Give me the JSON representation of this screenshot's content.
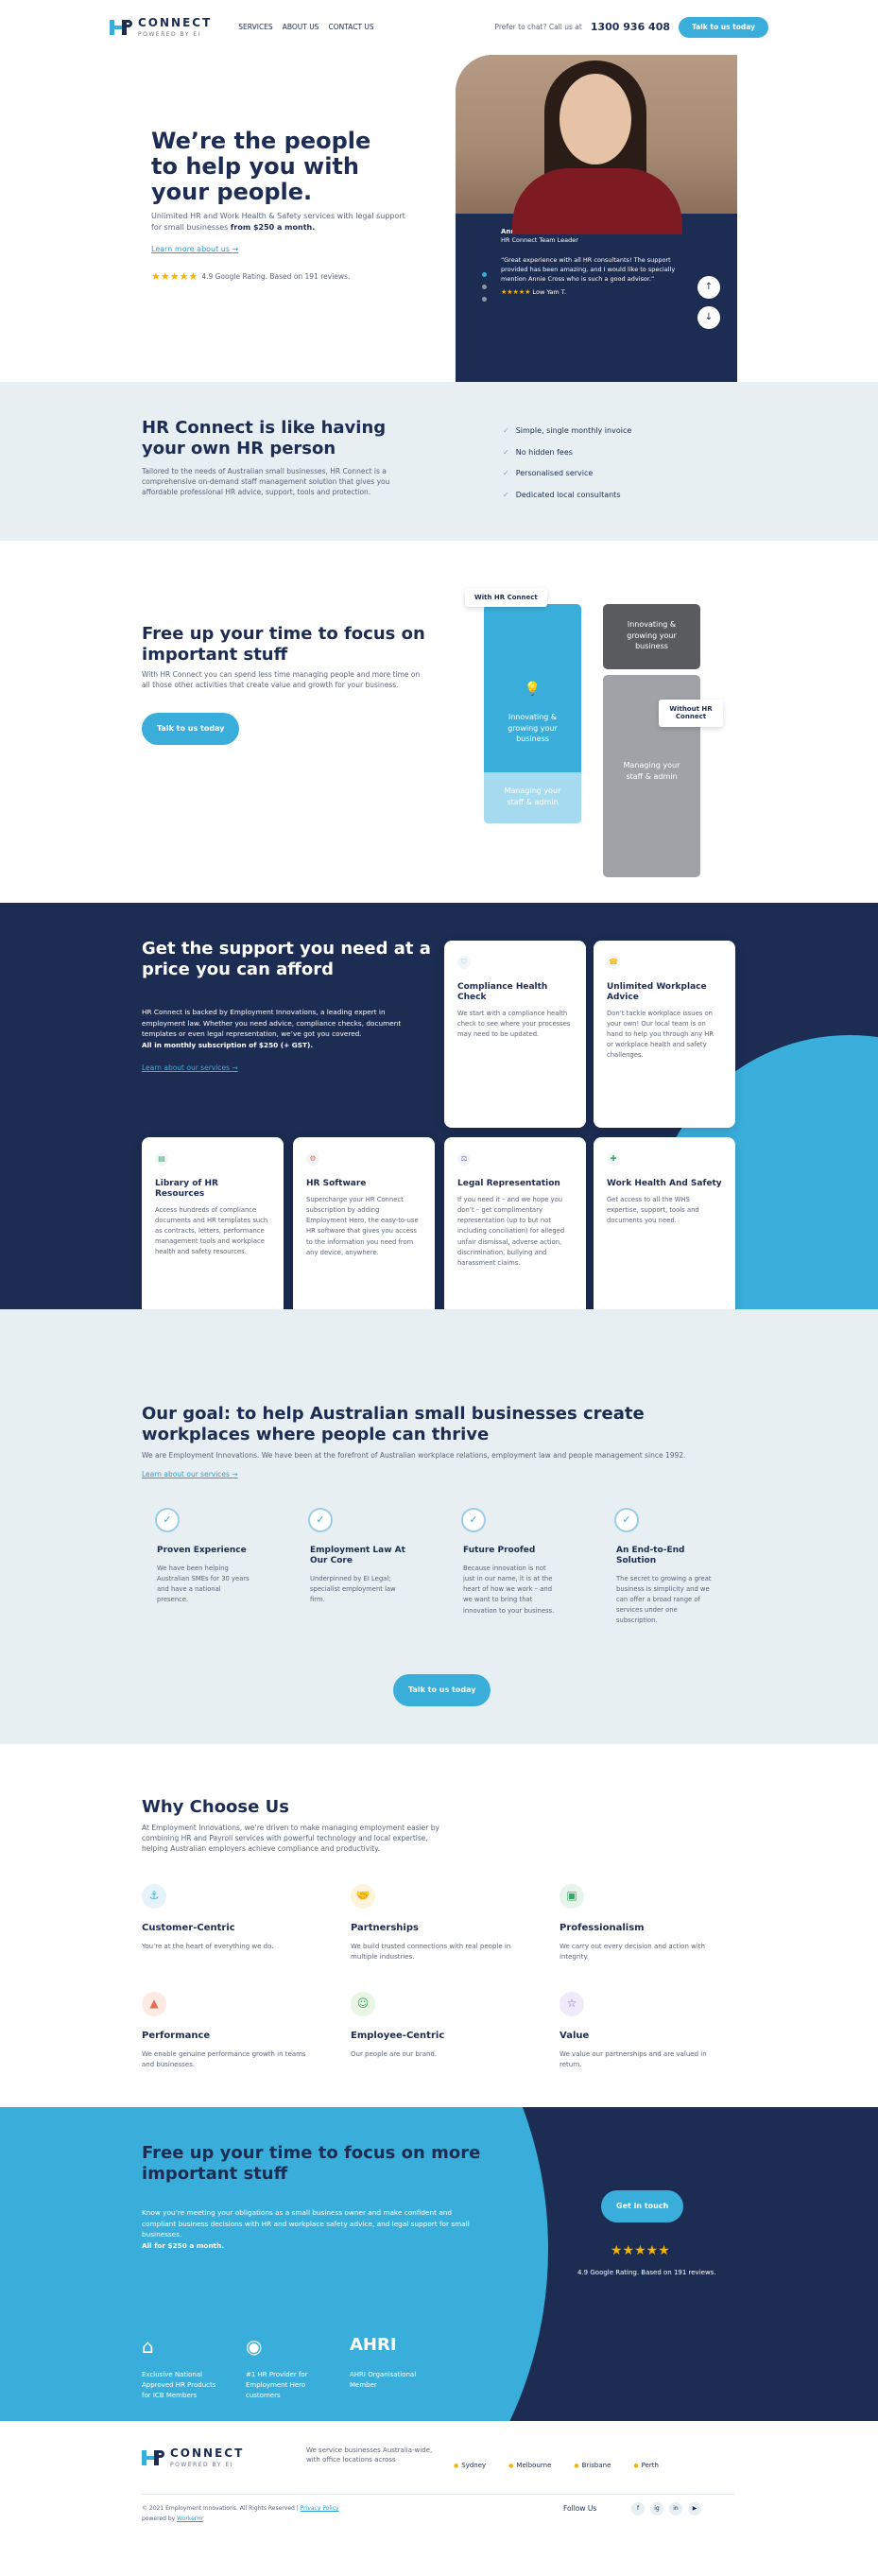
{
  "header": {
    "logo_text": "CONNECT",
    "logo_sub": "POWERED BY EI",
    "nav": [
      "SERVICES",
      "ABOUT US",
      "CONTACT US"
    ],
    "chat_prompt": "Prefer to chat? Call us at",
    "phone": "1300 936 408",
    "cta": "Talk to us today"
  },
  "hero": {
    "title": "We’re the people to help you with your people.",
    "subtitle": "Unlimited HR and Work Health & Safety services with legal support for small businesses",
    "price": "from $250 a month.",
    "learn": "Learn more about us →",
    "rating_stars": "★★★★★",
    "rating_text": "4.9 Google Rating. Based on 191 reviews.",
    "testimonial": {
      "name": "Annie",
      "role": "HR Connect Team Leader",
      "quote": "“Great experience with all HR consultants! The support provided has been amazing, and I would like to specially mention Annie Cross who is such a good advisor.”",
      "stars": "★★★★★",
      "author": "Low Yam T."
    },
    "arrow_up": "↑",
    "arrow_down": "↓"
  },
  "intro": {
    "title": "HR Connect is like having your own HR person",
    "text": "Tailored to the needs of Australian small businesses, HR Connect is a comprehensive on-demand staff management solution that gives you affordable professional HR advice, support, tools and protection.",
    "checks": [
      "Simple, single monthly invoice",
      "No hidden fees",
      "Personalised service",
      "Dedicated local consultants"
    ]
  },
  "free": {
    "title": "Free up your time to focus on important stuff",
    "text": "With HR Connect you can spend less time managing people and more time on all those other activities that create value and growth for your business.",
    "cta": "Talk to us today",
    "with_tag": "With HR Connect",
    "without_tag": "Without HR Connect",
    "with_main": "Innovating & growing your business",
    "with_bottom": "Managing your staff & admin",
    "without_top": "Innovating & growing your business",
    "without_main": "Managing your staff & admin"
  },
  "support": {
    "title": "Get the support you need at a price you can afford",
    "text": "HR Connect is backed by Employment Innovations, a leading expert in employment law. Whether you need advice, compliance checks, document templates or even legal representation, we’ve got you covered.",
    "price_line": "All in monthly subscription of $250 (+ GST).",
    "learn": "Learn about our services →",
    "cards": [
      {
        "icon": "♡",
        "title": "Compliance Health Check",
        "text": "We start with a compliance health check to see where your processes may need to be updated."
      },
      {
        "icon": "☎",
        "title": "Unlimited Workplace Advice",
        "text": "Don’t tackle workplace issues on your own! Our local team is on hand to help you through any HR or workplace health and safety challenges."
      },
      {
        "icon": "▤",
        "title": "Library of HR Resources",
        "text": "Access hundreds of compliance documents and HR templates such as contracts, letters, performance management tools and workplace health and safety resources."
      },
      {
        "icon": "⚙",
        "title": "HR Software",
        "text": "Supercharge your HR Connect subscription by adding Employment Hero, the easy-to-use HR software that gives you access to the information you need from any device, anywhere."
      },
      {
        "icon": "⚖",
        "title": "Legal Representation",
        "text": "If you need it – and we hope you don’t – get complimentary representation (up to but not including conciliation) for alleged unfair dismissal, adverse action, discrimination, bullying and harassment claims."
      },
      {
        "icon": "✚",
        "title": "Work Health And Safety",
        "text": "Get access to all the WHS expertise, support, tools and documents you need."
      }
    ]
  },
  "goal": {
    "title": "Our goal: to help Australian small businesses create workplaces where people can thrive",
    "text": "We are Employment Innovations. We have been at the forefront of Australian workplace relations, employment law and people management since 1992.",
    "learn": "Learn about our services →",
    "items": [
      {
        "title": "Proven Experience",
        "text": "We have been helping Australian SMEs for 30 years and have a national presence."
      },
      {
        "title": "Employment Law At Our Core",
        "text": "Underpinned by EI Legal; specialist employment law firm."
      },
      {
        "title": "Future Proofed",
        "text": "Because innovation is not just in our name, it is at the heart of how we work – and we want to bring that innovation to your business."
      },
      {
        "title": "An End-to-End Solution",
        "text": "The secret to growing a great business is simplicity and we can offer a broad range of services under one subscription."
      }
    ],
    "cta": "Talk to us today"
  },
  "why": {
    "title": "Why Choose Us",
    "text": "At Employment Innovations, we’re driven to make managing employment easier by combining HR and Payroll services with powerful technology and local expertise, helping Australian employers achieve compliance and productivity.",
    "items": [
      {
        "icon": "⚓",
        "color": "#e6f3fa",
        "title": "Customer-Centric",
        "text": "You’re at the heart of everything we do."
      },
      {
        "icon": "🤝",
        "color": "#fdf4dc",
        "title": "Partnerships",
        "text": "We build trusted connections with real people in multiple industries."
      },
      {
        "icon": "▣",
        "color": "#e5f5ea",
        "title": "Professionalism",
        "text": "We carry out every decision and action with integrity."
      },
      {
        "icon": "▲",
        "color": "#fdeae3",
        "title": "Performance",
        "text": "We enable genuine performance growth in teams and businesses."
      },
      {
        "icon": "☺",
        "color": "#eaf6e3",
        "title": "Employee-Centric",
        "text": "Our people are our brand."
      },
      {
        "icon": "☆",
        "color": "#efeaf9",
        "title": "Value",
        "text": "We value our partnerships and are valued in return."
      }
    ]
  },
  "cta": {
    "title": "Free up your time to focus on more important stuff",
    "text": "Know you’re meeting your obligations as a small business owner and make confident and compliant business decisions with HR and workplace safety advice, and legal support for small businesses.",
    "price": "All for $250 a month.",
    "button": "Get in touch",
    "stars": "★★★★★",
    "rating": "4.9 Google Rating. Based on 191 reviews.",
    "awards": [
      {
        "mark": "⌂",
        "text": "Exclusive National Approved HR Products for ICB Members"
      },
      {
        "mark": "◉",
        "text": "#1 HR Provider for Employment Hero customers"
      },
      {
        "mark": "AHRI",
        "text": "AHRI Organisational Member"
      }
    ]
  },
  "footer": {
    "service": "We service businesses Australia-wide, with office locations across",
    "cities": [
      "Sydney",
      "Melbourne",
      "Brisbane",
      "Perth"
    ],
    "copyright": "© 2021 Employment Innovations. All Rights Reserved |",
    "privacy": "Privacy Policy",
    "powered_by": "powered by",
    "agency": "WorkerHr",
    "follow": "Follow Us",
    "social": [
      "f",
      "ig",
      "in",
      "▶"
    ]
  }
}
